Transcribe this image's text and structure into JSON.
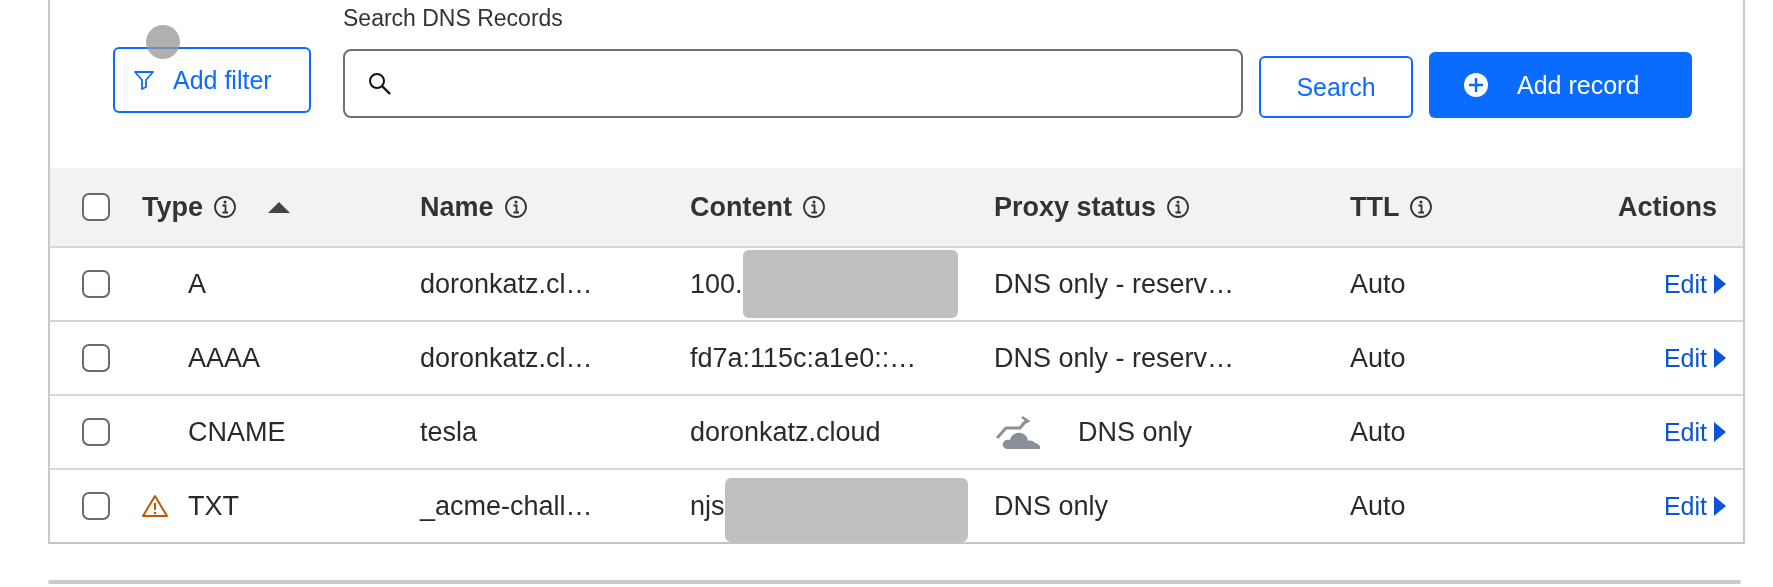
{
  "touch_indicator": true,
  "toolbar": {
    "filter_button": "Add filter",
    "search_label": "Search DNS Records",
    "search_button": "Search",
    "add_button": "Add record"
  },
  "table": {
    "columns": [
      {
        "label": "Type",
        "info": true,
        "sorted": true
      },
      {
        "label": "Name",
        "info": true,
        "sorted": false
      },
      {
        "label": "Content",
        "info": true,
        "sorted": false
      },
      {
        "label": "Proxy status",
        "info": true,
        "sorted": false
      },
      {
        "label": "TTL",
        "info": true,
        "sorted": false
      },
      {
        "label": "Actions",
        "info": false,
        "sorted": false
      }
    ],
    "header_checked": false,
    "rows": [
      {
        "checked": false,
        "warning": false,
        "type": "A",
        "name": "doronkatz.cl…",
        "content": "100.",
        "redacted": true,
        "proxy_icon": false,
        "proxy_status": "DNS only - reserv…",
        "ttl": "Auto",
        "action": "Edit"
      },
      {
        "checked": false,
        "warning": false,
        "type": "AAAA",
        "name": "doronkatz.cl…",
        "content": "fd7a:115c:a1e0::…",
        "redacted": false,
        "proxy_icon": false,
        "proxy_status": "DNS only - reserv…",
        "ttl": "Auto",
        "action": "Edit"
      },
      {
        "checked": false,
        "warning": false,
        "type": "CNAME",
        "name": "tesla",
        "content": "doronkatz.cloud",
        "redacted": false,
        "proxy_icon": true,
        "proxy_status": "DNS only",
        "ttl": "Auto",
        "action": "Edit"
      },
      {
        "checked": false,
        "warning": true,
        "type": "TXT",
        "name": "_acme-chall…",
        "content": "njs",
        "redacted": true,
        "proxy_icon": false,
        "proxy_status": "DNS only",
        "ttl": "Auto",
        "action": "Edit"
      }
    ]
  }
}
